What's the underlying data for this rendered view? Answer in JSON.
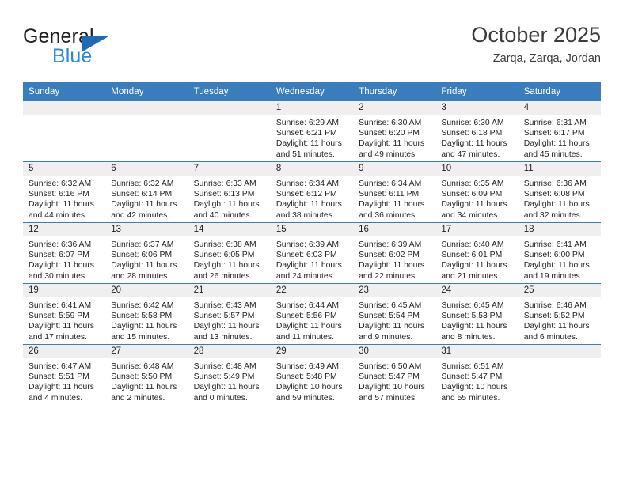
{
  "brand": {
    "name_top": "General",
    "name_bottom": "Blue",
    "triangle_color": "#1f6cb4",
    "blue_text_color": "#2b8ad6"
  },
  "header": {
    "title": "October 2025",
    "subtitle": "Zarqa, Zarqa, Jordan"
  },
  "theme": {
    "header_row_bg": "#3a7dbd",
    "header_row_text": "#ffffff",
    "daynum_band_bg": "#efefef",
    "cell_text": "#231f20",
    "row_border": "#3a7dbd"
  },
  "weekday_headers": [
    "Sunday",
    "Monday",
    "Tuesday",
    "Wednesday",
    "Thursday",
    "Friday",
    "Saturday"
  ],
  "labels": {
    "sunrise_prefix": "Sunrise:",
    "sunset_prefix": "Sunset:",
    "daylight_prefix": "Daylight:"
  },
  "weeks": [
    [
      {
        "empty": true
      },
      {
        "empty": true
      },
      {
        "empty": true
      },
      {
        "day": "1",
        "sunrise": "Sunrise: 6:29 AM",
        "sunset": "Sunset: 6:21 PM",
        "daylight_1": "Daylight: 11 hours",
        "daylight_2": "and 51 minutes."
      },
      {
        "day": "2",
        "sunrise": "Sunrise: 6:30 AM",
        "sunset": "Sunset: 6:20 PM",
        "daylight_1": "Daylight: 11 hours",
        "daylight_2": "and 49 minutes."
      },
      {
        "day": "3",
        "sunrise": "Sunrise: 6:30 AM",
        "sunset": "Sunset: 6:18 PM",
        "daylight_1": "Daylight: 11 hours",
        "daylight_2": "and 47 minutes."
      },
      {
        "day": "4",
        "sunrise": "Sunrise: 6:31 AM",
        "sunset": "Sunset: 6:17 PM",
        "daylight_1": "Daylight: 11 hours",
        "daylight_2": "and 45 minutes."
      }
    ],
    [
      {
        "day": "5",
        "sunrise": "Sunrise: 6:32 AM",
        "sunset": "Sunset: 6:16 PM",
        "daylight_1": "Daylight: 11 hours",
        "daylight_2": "and 44 minutes."
      },
      {
        "day": "6",
        "sunrise": "Sunrise: 6:32 AM",
        "sunset": "Sunset: 6:14 PM",
        "daylight_1": "Daylight: 11 hours",
        "daylight_2": "and 42 minutes."
      },
      {
        "day": "7",
        "sunrise": "Sunrise: 6:33 AM",
        "sunset": "Sunset: 6:13 PM",
        "daylight_1": "Daylight: 11 hours",
        "daylight_2": "and 40 minutes."
      },
      {
        "day": "8",
        "sunrise": "Sunrise: 6:34 AM",
        "sunset": "Sunset: 6:12 PM",
        "daylight_1": "Daylight: 11 hours",
        "daylight_2": "and 38 minutes."
      },
      {
        "day": "9",
        "sunrise": "Sunrise: 6:34 AM",
        "sunset": "Sunset: 6:11 PM",
        "daylight_1": "Daylight: 11 hours",
        "daylight_2": "and 36 minutes."
      },
      {
        "day": "10",
        "sunrise": "Sunrise: 6:35 AM",
        "sunset": "Sunset: 6:09 PM",
        "daylight_1": "Daylight: 11 hours",
        "daylight_2": "and 34 minutes."
      },
      {
        "day": "11",
        "sunrise": "Sunrise: 6:36 AM",
        "sunset": "Sunset: 6:08 PM",
        "daylight_1": "Daylight: 11 hours",
        "daylight_2": "and 32 minutes."
      }
    ],
    [
      {
        "day": "12",
        "sunrise": "Sunrise: 6:36 AM",
        "sunset": "Sunset: 6:07 PM",
        "daylight_1": "Daylight: 11 hours",
        "daylight_2": "and 30 minutes."
      },
      {
        "day": "13",
        "sunrise": "Sunrise: 6:37 AM",
        "sunset": "Sunset: 6:06 PM",
        "daylight_1": "Daylight: 11 hours",
        "daylight_2": "and 28 minutes."
      },
      {
        "day": "14",
        "sunrise": "Sunrise: 6:38 AM",
        "sunset": "Sunset: 6:05 PM",
        "daylight_1": "Daylight: 11 hours",
        "daylight_2": "and 26 minutes."
      },
      {
        "day": "15",
        "sunrise": "Sunrise: 6:39 AM",
        "sunset": "Sunset: 6:03 PM",
        "daylight_1": "Daylight: 11 hours",
        "daylight_2": "and 24 minutes."
      },
      {
        "day": "16",
        "sunrise": "Sunrise: 6:39 AM",
        "sunset": "Sunset: 6:02 PM",
        "daylight_1": "Daylight: 11 hours",
        "daylight_2": "and 22 minutes."
      },
      {
        "day": "17",
        "sunrise": "Sunrise: 6:40 AM",
        "sunset": "Sunset: 6:01 PM",
        "daylight_1": "Daylight: 11 hours",
        "daylight_2": "and 21 minutes."
      },
      {
        "day": "18",
        "sunrise": "Sunrise: 6:41 AM",
        "sunset": "Sunset: 6:00 PM",
        "daylight_1": "Daylight: 11 hours",
        "daylight_2": "and 19 minutes."
      }
    ],
    [
      {
        "day": "19",
        "sunrise": "Sunrise: 6:41 AM",
        "sunset": "Sunset: 5:59 PM",
        "daylight_1": "Daylight: 11 hours",
        "daylight_2": "and 17 minutes."
      },
      {
        "day": "20",
        "sunrise": "Sunrise: 6:42 AM",
        "sunset": "Sunset: 5:58 PM",
        "daylight_1": "Daylight: 11 hours",
        "daylight_2": "and 15 minutes."
      },
      {
        "day": "21",
        "sunrise": "Sunrise: 6:43 AM",
        "sunset": "Sunset: 5:57 PM",
        "daylight_1": "Daylight: 11 hours",
        "daylight_2": "and 13 minutes."
      },
      {
        "day": "22",
        "sunrise": "Sunrise: 6:44 AM",
        "sunset": "Sunset: 5:56 PM",
        "daylight_1": "Daylight: 11 hours",
        "daylight_2": "and 11 minutes."
      },
      {
        "day": "23",
        "sunrise": "Sunrise: 6:45 AM",
        "sunset": "Sunset: 5:54 PM",
        "daylight_1": "Daylight: 11 hours",
        "daylight_2": "and 9 minutes."
      },
      {
        "day": "24",
        "sunrise": "Sunrise: 6:45 AM",
        "sunset": "Sunset: 5:53 PM",
        "daylight_1": "Daylight: 11 hours",
        "daylight_2": "and 8 minutes."
      },
      {
        "day": "25",
        "sunrise": "Sunrise: 6:46 AM",
        "sunset": "Sunset: 5:52 PM",
        "daylight_1": "Daylight: 11 hours",
        "daylight_2": "and 6 minutes."
      }
    ],
    [
      {
        "day": "26",
        "sunrise": "Sunrise: 6:47 AM",
        "sunset": "Sunset: 5:51 PM",
        "daylight_1": "Daylight: 11 hours",
        "daylight_2": "and 4 minutes."
      },
      {
        "day": "27",
        "sunrise": "Sunrise: 6:48 AM",
        "sunset": "Sunset: 5:50 PM",
        "daylight_1": "Daylight: 11 hours",
        "daylight_2": "and 2 minutes."
      },
      {
        "day": "28",
        "sunrise": "Sunrise: 6:48 AM",
        "sunset": "Sunset: 5:49 PM",
        "daylight_1": "Daylight: 11 hours",
        "daylight_2": "and 0 minutes."
      },
      {
        "day": "29",
        "sunrise": "Sunrise: 6:49 AM",
        "sunset": "Sunset: 5:48 PM",
        "daylight_1": "Daylight: 10 hours",
        "daylight_2": "and 59 minutes."
      },
      {
        "day": "30",
        "sunrise": "Sunrise: 6:50 AM",
        "sunset": "Sunset: 5:47 PM",
        "daylight_1": "Daylight: 10 hours",
        "daylight_2": "and 57 minutes."
      },
      {
        "day": "31",
        "sunrise": "Sunrise: 6:51 AM",
        "sunset": "Sunset: 5:47 PM",
        "daylight_1": "Daylight: 10 hours",
        "daylight_2": "and 55 minutes."
      },
      {
        "empty": true
      }
    ]
  ]
}
